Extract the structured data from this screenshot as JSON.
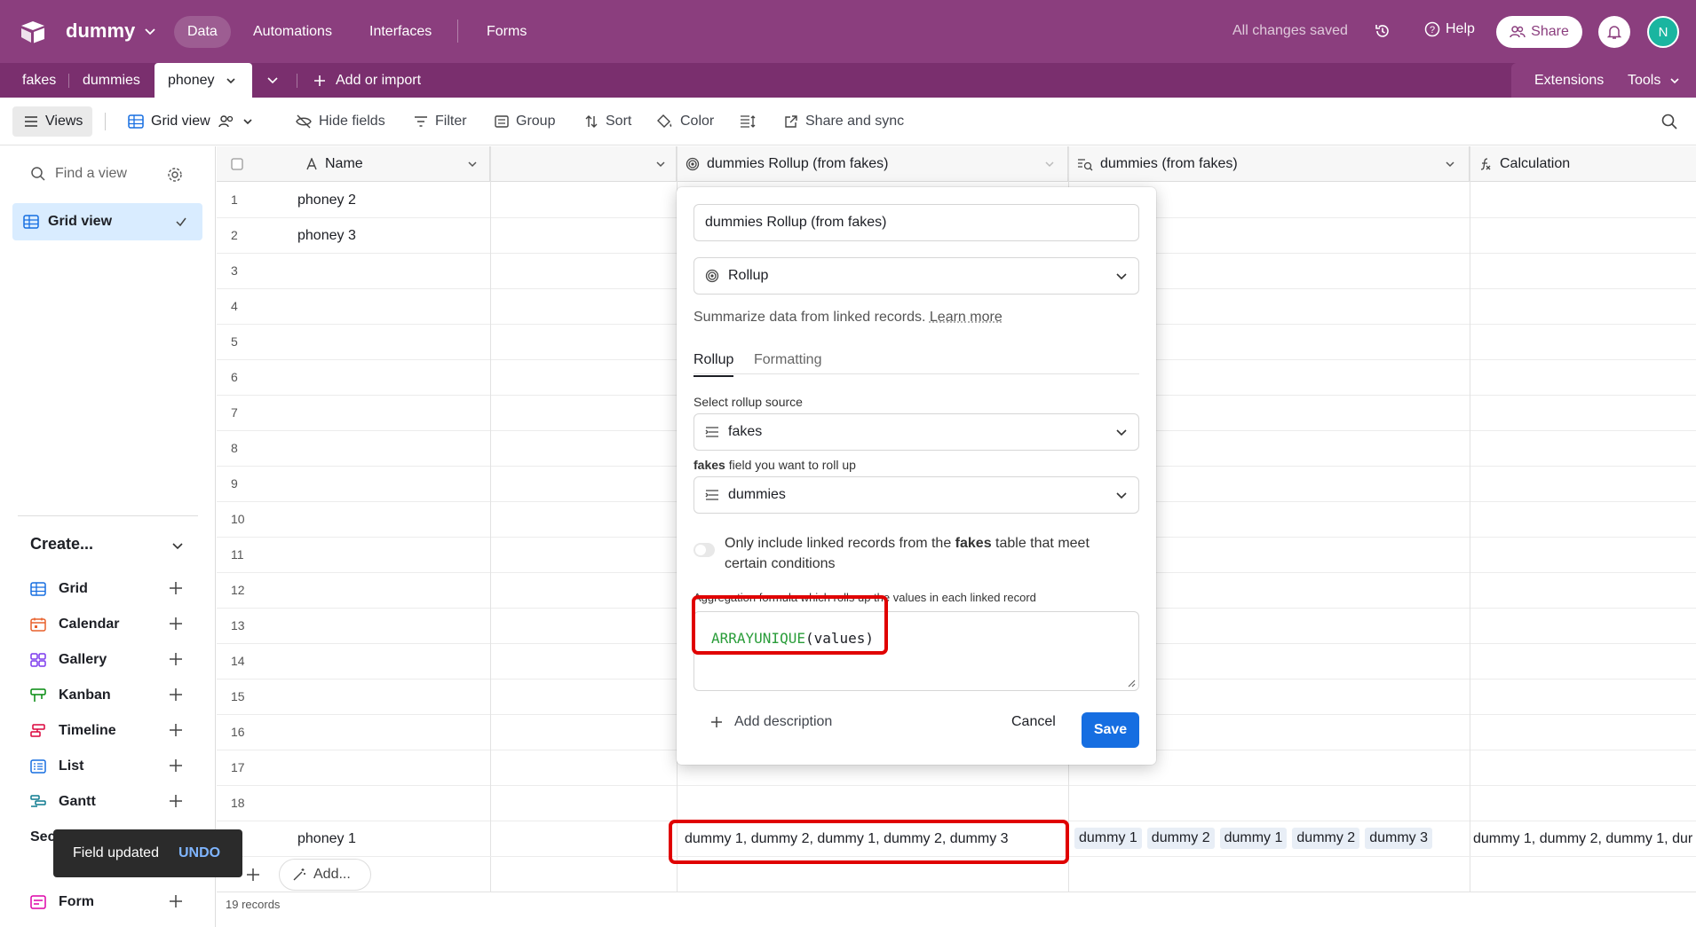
{
  "header": {
    "base_name": "dummy",
    "nav_tabs": [
      "Data",
      "Automations",
      "Interfaces",
      "Forms"
    ],
    "save_status": "All changes saved",
    "help_label": "Help",
    "share_label": "Share",
    "avatar_initial": "N"
  },
  "tables": {
    "tabs": [
      "fakes",
      "dummies",
      "phoney"
    ],
    "active": "phoney",
    "add_import": "Add or import",
    "extensions": "Extensions",
    "tools": "Tools"
  },
  "viewbar": {
    "views": "Views",
    "view_name": "Grid view",
    "hide_fields": "Hide fields",
    "filter": "Filter",
    "group": "Group",
    "sort": "Sort",
    "color": "Color",
    "share_sync": "Share and sync"
  },
  "sidebar": {
    "find_placeholder": "Find a view",
    "active_view": "Grid view",
    "create_label": "Create...",
    "create_items": [
      "Grid",
      "Calendar",
      "Gallery",
      "Kanban",
      "Timeline",
      "List",
      "Gantt"
    ],
    "section_label": "Sec",
    "form_label": "Form"
  },
  "grid": {
    "columns": {
      "name": "Name",
      "rollup": "dummies Rollup (from fakes)",
      "lookup": "dummies (from fakes)",
      "calc": "Calculation"
    },
    "rows": [
      {
        "n": "1",
        "name": "phoney 2"
      },
      {
        "n": "2",
        "name": "phoney 3"
      },
      {
        "n": "3",
        "name": ""
      },
      {
        "n": "4",
        "name": ""
      },
      {
        "n": "5",
        "name": ""
      },
      {
        "n": "6",
        "name": ""
      },
      {
        "n": "7",
        "name": ""
      },
      {
        "n": "8",
        "name": ""
      },
      {
        "n": "9",
        "name": ""
      },
      {
        "n": "10",
        "name": ""
      },
      {
        "n": "11",
        "name": ""
      },
      {
        "n": "12",
        "name": ""
      },
      {
        "n": "13",
        "name": ""
      },
      {
        "n": "14",
        "name": ""
      },
      {
        "n": "15",
        "name": ""
      },
      {
        "n": "16",
        "name": ""
      },
      {
        "n": "17",
        "name": ""
      },
      {
        "n": "18",
        "name": ""
      }
    ],
    "last_row_name": "phoney 1",
    "last_row_rollup": "dummy 1, dummy 2, dummy 1, dummy 2, dummy 3",
    "last_row_lookup_tags": [
      "dummy 1",
      "dummy 2",
      "dummy 1",
      "dummy 2",
      "dummy 3"
    ],
    "last_row_calc": "dummy 1, dummy 2, dummy 1, dur",
    "add_label": "Add...",
    "records": "19 records"
  },
  "popup": {
    "field_name": "dummies Rollup (from fakes)",
    "field_type": "Rollup",
    "description": "Summarize data from linked records.",
    "learn_more": "Learn more",
    "tabs": [
      "Rollup",
      "Formatting"
    ],
    "source_label": "Select rollup source",
    "source_value": "fakes",
    "rollfield_label_bold": "fakes",
    "rollfield_label_rest": " field you want to roll up",
    "rollfield_value": "dummies",
    "condition_pre": "Only include linked records from the ",
    "condition_bold": "fakes",
    "condition_post": " table that meet certain conditions",
    "formula_label": "Aggregation formula which rolls up the values in each linked record",
    "formula_fn": "ARRAYUNIQUE",
    "formula_args": "(values)",
    "add_description": "Add description",
    "cancel": "Cancel",
    "save": "Save"
  },
  "toast": {
    "message": "Field updated",
    "action": "UNDO"
  }
}
